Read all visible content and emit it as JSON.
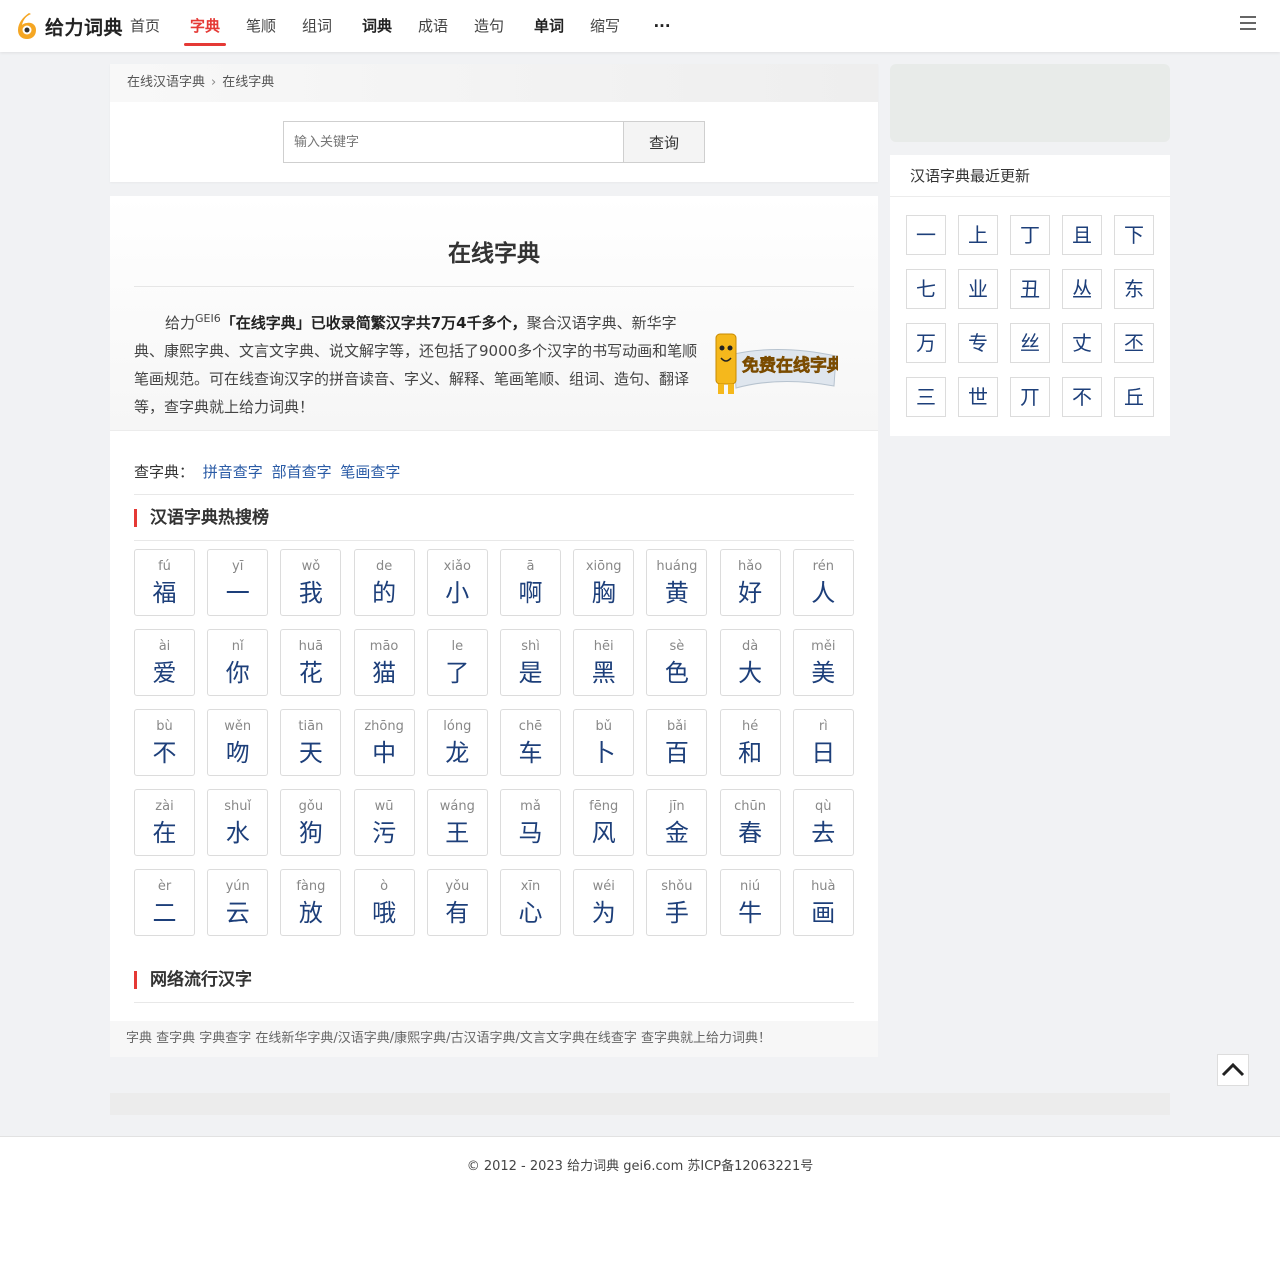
{
  "brand": {
    "name": "给力词典",
    "accent": "#e53935",
    "link_color": "#2a5ba6",
    "char_color": "#1d3f7a"
  },
  "nav": {
    "items": [
      {
        "label": "首页"
      },
      {
        "label": "字典"
      },
      {
        "label": "笔顺"
      },
      {
        "label": "组词"
      },
      {
        "label": "词典"
      },
      {
        "label": "成语"
      },
      {
        "label": "造句"
      },
      {
        "label": "单词"
      },
      {
        "label": "缩写"
      },
      {
        "label": "···"
      }
    ],
    "active": "字典"
  },
  "breadcrumb": {
    "root": "在线汉语字典",
    "current": "在线字典"
  },
  "search": {
    "placeholder": "输入关键字",
    "button": "查询"
  },
  "intro": {
    "title": "在线字典",
    "brand_prefix": "给力",
    "brand_sup": "GEI6",
    "bold_text": "「在线字典」已收录简繁汉字共7万4千多个，",
    "rest_text": "聚合汉语字典、新华字典、康熙字典、文言文字典、说文解字等，还包括了9000多个汉字的书写动画和笔顺笔画规范。可在线查询汉字的拼音读音、字义、解释、笔画笔顺、组词、造句、翻译等，查字典就上给力词典！",
    "mascot_caption": "免费在线字典"
  },
  "lookup": {
    "label": "查字典：",
    "links": [
      "拼音查字",
      "部首查字",
      "笔画查字"
    ]
  },
  "hot": {
    "title": "汉语字典热搜榜",
    "chars": [
      {
        "py": "fú",
        "hz": "福"
      },
      {
        "py": "yī",
        "hz": "一"
      },
      {
        "py": "wǒ",
        "hz": "我"
      },
      {
        "py": "de",
        "hz": "的"
      },
      {
        "py": "xiǎo",
        "hz": "小"
      },
      {
        "py": "ā",
        "hz": "啊"
      },
      {
        "py": "xiōng",
        "hz": "胸"
      },
      {
        "py": "huáng",
        "hz": "黄"
      },
      {
        "py": "hǎo",
        "hz": "好"
      },
      {
        "py": "rén",
        "hz": "人"
      },
      {
        "py": "ài",
        "hz": "爱"
      },
      {
        "py": "nǐ",
        "hz": "你"
      },
      {
        "py": "huā",
        "hz": "花"
      },
      {
        "py": "māo",
        "hz": "猫"
      },
      {
        "py": "le",
        "hz": "了"
      },
      {
        "py": "shì",
        "hz": "是"
      },
      {
        "py": "hēi",
        "hz": "黑"
      },
      {
        "py": "sè",
        "hz": "色"
      },
      {
        "py": "dà",
        "hz": "大"
      },
      {
        "py": "měi",
        "hz": "美"
      },
      {
        "py": "bù",
        "hz": "不"
      },
      {
        "py": "wěn",
        "hz": "吻"
      },
      {
        "py": "tiān",
        "hz": "天"
      },
      {
        "py": "zhōng",
        "hz": "中"
      },
      {
        "py": "lóng",
        "hz": "龙"
      },
      {
        "py": "chē",
        "hz": "车"
      },
      {
        "py": "bǔ",
        "hz": "卜"
      },
      {
        "py": "bǎi",
        "hz": "百"
      },
      {
        "py": "hé",
        "hz": "和"
      },
      {
        "py": "rì",
        "hz": "日"
      },
      {
        "py": "zài",
        "hz": "在"
      },
      {
        "py": "shuǐ",
        "hz": "水"
      },
      {
        "py": "gǒu",
        "hz": "狗"
      },
      {
        "py": "wū",
        "hz": "污"
      },
      {
        "py": "wáng",
        "hz": "王"
      },
      {
        "py": "mǎ",
        "hz": "马"
      },
      {
        "py": "fēng",
        "hz": "风"
      },
      {
        "py": "jīn",
        "hz": "金"
      },
      {
        "py": "chūn",
        "hz": "春"
      },
      {
        "py": "qù",
        "hz": "去"
      },
      {
        "py": "èr",
        "hz": "二"
      },
      {
        "py": "yún",
        "hz": "云"
      },
      {
        "py": "fàng",
        "hz": "放"
      },
      {
        "py": "ò",
        "hz": "哦"
      },
      {
        "py": "yǒu",
        "hz": "有"
      },
      {
        "py": "xīn",
        "hz": "心"
      },
      {
        "py": "wéi",
        "hz": "为"
      },
      {
        "py": "shǒu",
        "hz": "手"
      },
      {
        "py": "niú",
        "hz": "牛"
      },
      {
        "py": "huà",
        "hz": "画"
      }
    ]
  },
  "popular": {
    "title": "网络流行汉字"
  },
  "tags_line": "字典 查字典 字典查字 在线新华字典/汉语字典/康熙字典/古汉语字典/文言文字典在线查字 查字典就上给力词典！",
  "recent": {
    "title": "汉语字典最近更新",
    "chars": [
      "一",
      "上",
      "丁",
      "且",
      "下",
      "七",
      "业",
      "丑",
      "丛",
      "东",
      "万",
      "专",
      "丝",
      "丈",
      "丕",
      "三",
      "世",
      "丌",
      "不",
      "丘"
    ]
  },
  "footer": {
    "text": "© 2012 - 2023 给力词典 gei6.com 苏ICP备12063221号"
  }
}
